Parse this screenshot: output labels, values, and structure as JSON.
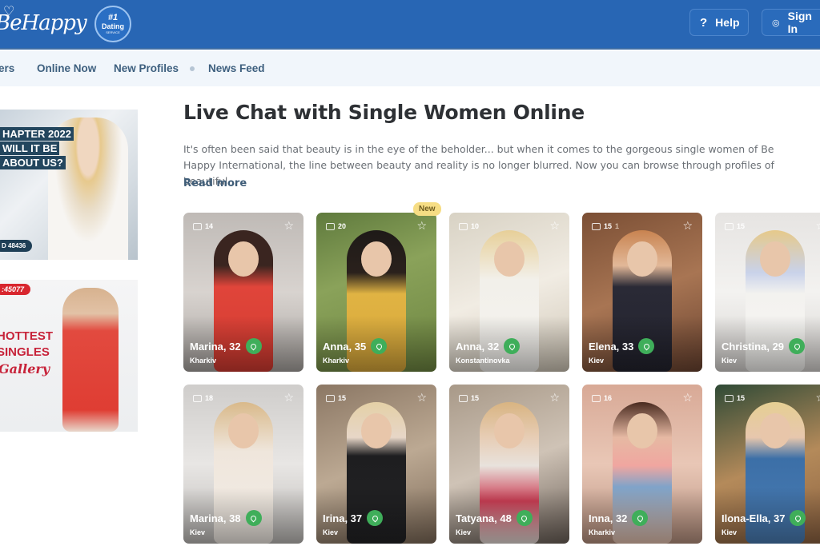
{
  "header": {
    "logo_text": "BeHappy",
    "logo_icon": "heart-icon",
    "badge": {
      "line1": "#1",
      "line2": "Dating",
      "line3": "SERVICE"
    },
    "help_button": {
      "icon": "question-icon",
      "label": "Help"
    },
    "signin_button": {
      "icon": "user-circle-icon",
      "label": "Sign In"
    },
    "brand_color": "#2866b4"
  },
  "nav": {
    "items": [
      {
        "label": "ers"
      },
      {
        "label": "Online Now"
      },
      {
        "label": "New Profiles"
      },
      {
        "label": "News Feed"
      }
    ]
  },
  "sidebar": {
    "ads": [
      {
        "lines": [
          "HAPTER 2022",
          "WILL IT BE",
          "ABOUT US?"
        ],
        "pill": "D 48436"
      },
      {
        "pill": ":45077",
        "lines": [
          "HOTTEST",
          "SINGLES",
          "Gallery"
        ]
      }
    ]
  },
  "main": {
    "title": "Live Chat with Single Women Online",
    "description": "It's often been said that beauty is in the eye of the beholder... but when it comes to the gorgeous single women of Be Happy International, the line between beauty and reality is no longer blurred. Now you can browse through profiles of beautiful...",
    "read_more": "Read more",
    "new_badge": "New",
    "profiles": [
      {
        "name": "Marina, 32",
        "city": "Kharkiv",
        "photos": "14",
        "videos": ""
      },
      {
        "name": "Anna, 35",
        "city": "Kharkiv",
        "photos": "20",
        "videos": "",
        "is_new": true
      },
      {
        "name": "Anna, 32",
        "city": "Konstantinovka",
        "photos": "10",
        "videos": ""
      },
      {
        "name": "Elena, 33",
        "city": "Kiev",
        "photos": "15",
        "videos": "1"
      },
      {
        "name": "Christina, 29",
        "city": "Kiev",
        "photos": "15",
        "videos": ""
      },
      {
        "name": "Marina, 38",
        "city": "Kiev",
        "photos": "18",
        "videos": ""
      },
      {
        "name": "Irina, 37",
        "city": "Kiev",
        "photos": "15",
        "videos": ""
      },
      {
        "name": "Tatyana, 48",
        "city": "Kiev",
        "photos": "15",
        "videos": ""
      },
      {
        "name": "Inna, 32",
        "city": "Kharkiv",
        "photos": "16",
        "videos": ""
      },
      {
        "name": "Ilona-Ella, 37",
        "city": "Kiev",
        "photos": "15",
        "videos": ""
      }
    ],
    "online_indicator_color": "#3fae5a"
  }
}
